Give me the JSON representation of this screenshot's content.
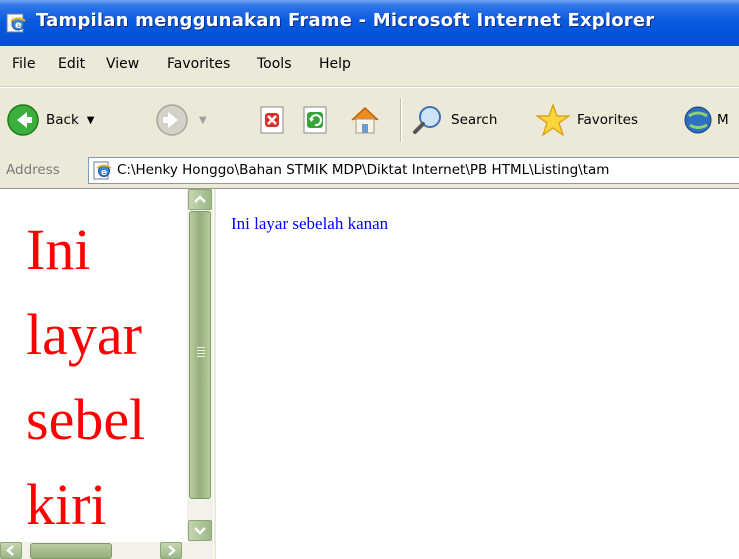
{
  "window": {
    "title": "Tampilan menggunakan Frame - Microsoft Internet Explorer",
    "icon": "ie-page-icon"
  },
  "menu": {
    "items": [
      "File",
      "Edit",
      "View",
      "Favorites",
      "Tools",
      "Help"
    ]
  },
  "toolbar": {
    "back_label": "Back",
    "search_label": "Search",
    "favorites_label": "Favorites",
    "media_label": "M"
  },
  "address": {
    "label": "Address",
    "value": "C:\\Henky Honggo\\Bahan STMIK MDP\\Diktat Internet\\PB HTML\\Listing\\tam"
  },
  "frames": {
    "left_text": "Ini layar sebel kiri",
    "right_text": "Ini layar sebelah kanan"
  },
  "colors": {
    "titlebar": "#0a5ae0",
    "left_text": "#ff0000",
    "right_text": "#0000ff",
    "scrollbar": "#9bb786"
  }
}
